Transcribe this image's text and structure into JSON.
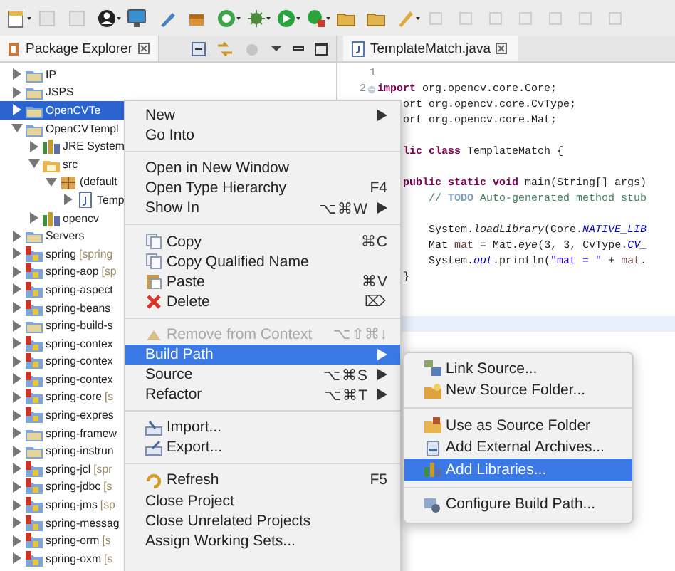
{
  "explorer": {
    "title": "Package Explorer",
    "tree": [
      {
        "label": "IP",
        "kind": "project",
        "expanded": false,
        "selected": false
      },
      {
        "label": "JSPS",
        "kind": "project",
        "expanded": false,
        "selected": false
      },
      {
        "label": "OpenCVTe",
        "kind": "project",
        "expanded": false,
        "selected": true
      },
      {
        "label": "OpenCVTempl",
        "kind": "project",
        "expanded": true,
        "selected": false,
        "children": [
          {
            "label": "JRE System",
            "kind": "library",
            "expanded": false,
            "selected": false
          },
          {
            "label": "src",
            "kind": "folder",
            "expanded": true,
            "selected": false,
            "children": [
              {
                "label": "(default",
                "kind": "package",
                "expanded": true,
                "selected": false,
                "children": [
                  {
                    "label": "Temp",
                    "kind": "java",
                    "expanded": false,
                    "selected": false
                  }
                ]
              }
            ]
          },
          {
            "label": "opencv",
            "kind": "library",
            "expanded": false,
            "selected": false
          }
        ]
      },
      {
        "label": "Servers",
        "kind": "project",
        "expanded": false,
        "selected": false
      },
      {
        "label": "spring",
        "decoration": "[spring",
        "kind": "spring",
        "expanded": false,
        "selected": false
      },
      {
        "label": "spring-aop",
        "decoration": "[sp",
        "kind": "spring",
        "expanded": false,
        "selected": false
      },
      {
        "label": "spring-aspect",
        "kind": "spring",
        "expanded": false,
        "selected": false
      },
      {
        "label": "spring-beans",
        "kind": "spring",
        "expanded": false,
        "selected": false
      },
      {
        "label": "spring-build-s",
        "kind": "project",
        "expanded": false,
        "selected": false
      },
      {
        "label": "spring-contex",
        "kind": "spring",
        "expanded": false,
        "selected": false
      },
      {
        "label": "spring-contex",
        "kind": "spring",
        "expanded": false,
        "selected": false
      },
      {
        "label": "spring-contex",
        "kind": "spring",
        "expanded": false,
        "selected": false
      },
      {
        "label": "spring-core",
        "decoration": "[s",
        "kind": "spring",
        "expanded": false,
        "selected": false
      },
      {
        "label": "spring-expres",
        "kind": "spring",
        "expanded": false,
        "selected": false
      },
      {
        "label": "spring-framew",
        "kind": "project",
        "expanded": false,
        "selected": false
      },
      {
        "label": "spring-instrun",
        "kind": "project",
        "expanded": false,
        "selected": false
      },
      {
        "label": "spring-jcl",
        "decoration": "[spr",
        "kind": "spring",
        "expanded": false,
        "selected": false
      },
      {
        "label": "spring-jdbc",
        "decoration": "[s",
        "kind": "spring",
        "expanded": false,
        "selected": false
      },
      {
        "label": "spring-jms",
        "decoration": "[sp",
        "kind": "spring",
        "expanded": false,
        "selected": false
      },
      {
        "label": "spring-messag",
        "kind": "spring",
        "expanded": false,
        "selected": false
      },
      {
        "label": "spring-orm",
        "decoration": "[s",
        "kind": "spring",
        "expanded": false,
        "selected": false
      },
      {
        "label": "spring-oxm",
        "decoration": "[s",
        "kind": "spring",
        "expanded": false,
        "selected": false
      }
    ]
  },
  "editor": {
    "tab": "TemplateMatch.java",
    "lines": [
      {
        "kind": "full",
        "number": "1"
      },
      {
        "kind": "folded",
        "number": "2",
        "parts": [
          {
            "t": "import",
            "kind": "keyword"
          },
          {
            "t": " org.opencv.core.Core;",
            "kind": "plain"
          }
        ]
      },
      {
        "kind": "clipped",
        "parts": [
          {
            "t": "ort org.opencv.core.CvType;",
            "kind": "plain"
          }
        ]
      },
      {
        "kind": "clipped",
        "parts": [
          {
            "t": "ort org.opencv.core.Mat;",
            "kind": "plain"
          }
        ]
      },
      {
        "kind": "blank"
      },
      {
        "kind": "clipped",
        "parts": [
          {
            "t": "lic class",
            "kind": "keyword"
          },
          {
            "t": " TemplateMatch {",
            "kind": "plain"
          }
        ]
      },
      {
        "kind": "blank"
      },
      {
        "kind": "full",
        "parts": [
          {
            "t": "    public static void",
            "kind": "keyword"
          },
          {
            "t": " main(String[] args)",
            "kind": "plain"
          }
        ]
      },
      {
        "kind": "full",
        "parts": [
          {
            "t": "        // ",
            "kind": "comment"
          },
          {
            "t": "TODO",
            "kind": "task"
          },
          {
            "t": " Auto-generated method stub",
            "kind": "comment"
          }
        ]
      },
      {
        "kind": "blank"
      },
      {
        "kind": "full",
        "parts": [
          {
            "t": "        System.",
            "kind": "plain"
          },
          {
            "t": "loadLibrary",
            "kind": "method"
          },
          {
            "t": "(Core.",
            "kind": "plain"
          },
          {
            "t": "NATIVE_LIB",
            "kind": "field"
          }
        ]
      },
      {
        "kind": "full",
        "parts": [
          {
            "t": "        Mat ",
            "kind": "plain"
          },
          {
            "t": "mat",
            "kind": "variable"
          },
          {
            "t": " = Mat.",
            "kind": "plain"
          },
          {
            "t": "eye",
            "kind": "method"
          },
          {
            "t": "(3, 3, CvType.",
            "kind": "plain"
          },
          {
            "t": "CV_",
            "kind": "field"
          }
        ]
      },
      {
        "kind": "full",
        "parts": [
          {
            "t": "        System.",
            "kind": "plain"
          },
          {
            "t": "out",
            "kind": "field"
          },
          {
            "t": ".println(",
            "kind": "plain"
          },
          {
            "t": "\"mat = \"",
            "kind": "string"
          },
          {
            "t": " + ",
            "kind": "plain"
          },
          {
            "t": "mat",
            "kind": "variable"
          },
          {
            "t": ".",
            "kind": "plain"
          }
        ]
      },
      {
        "kind": "full",
        "parts": [
          {
            "t": "    }",
            "kind": "plain"
          }
        ]
      },
      {
        "kind": "blank"
      },
      {
        "kind": "blank"
      },
      {
        "kind": "current"
      }
    ]
  },
  "context_menu": {
    "items": [
      {
        "kind": "item",
        "label": "New",
        "submenu": true,
        "disabled": false,
        "selected": false
      },
      {
        "kind": "item",
        "label": "Go Into",
        "submenu": false,
        "disabled": false,
        "selected": false
      },
      {
        "kind": "separator"
      },
      {
        "kind": "item",
        "label": "Open in New Window",
        "submenu": false,
        "disabled": false,
        "selected": false
      },
      {
        "kind": "item",
        "label": "Open Type Hierarchy",
        "shortcut": "F4",
        "submenu": false,
        "disabled": false,
        "selected": false
      },
      {
        "kind": "item",
        "label": "Show In",
        "shortcut": "⌥⌘W",
        "submenu": true,
        "disabled": false,
        "selected": false
      },
      {
        "kind": "separator"
      },
      {
        "kind": "copy",
        "label": "Copy",
        "shortcut": "⌘C",
        "submenu": false,
        "disabled": false,
        "selected": false
      },
      {
        "kind": "copy",
        "label": "Copy Qualified Name",
        "submenu": false,
        "disabled": false,
        "selected": false
      },
      {
        "kind": "paste",
        "label": "Paste",
        "shortcut": "⌘V",
        "submenu": false,
        "disabled": false,
        "selected": false
      },
      {
        "kind": "delete",
        "label": "Delete",
        "shortcut": "⌦",
        "submenu": false,
        "disabled": false,
        "selected": false
      },
      {
        "kind": "separator"
      },
      {
        "kind": "remove",
        "label": "Remove from Context",
        "shortcut": "⌥⇧⌘↓",
        "submenu": false,
        "disabled": true,
        "selected": false
      },
      {
        "kind": "item",
        "label": "Build Path",
        "submenu": true,
        "disabled": false,
        "selected": true
      },
      {
        "kind": "item",
        "label": "Source",
        "shortcut": "⌥⌘S",
        "submenu": true,
        "disabled": false,
        "selected": false
      },
      {
        "kind": "item",
        "label": "Refactor",
        "shortcut": "⌥⌘T",
        "submenu": true,
        "disabled": false,
        "selected": false
      },
      {
        "kind": "separator"
      },
      {
        "kind": "import",
        "label": "Import...",
        "submenu": false,
        "disabled": false,
        "selected": false
      },
      {
        "kind": "export",
        "label": "Export...",
        "submenu": false,
        "disabled": false,
        "selected": false
      },
      {
        "kind": "separator"
      },
      {
        "kind": "refresh",
        "label": "Refresh",
        "shortcut": "F5",
        "submenu": false,
        "disabled": false,
        "selected": false
      },
      {
        "kind": "item",
        "label": "Close Project",
        "submenu": false,
        "disabled": false,
        "selected": false
      },
      {
        "kind": "item",
        "label": "Close Unrelated Projects",
        "submenu": false,
        "disabled": false,
        "selected": false
      },
      {
        "kind": "item",
        "label": "Assign Working Sets...",
        "submenu": false,
        "disabled": false,
        "selected": false
      }
    ]
  },
  "submenu": {
    "items": [
      {
        "kind": "link",
        "label": "Link Source...",
        "selected": false
      },
      {
        "kind": "folder",
        "label": "New Source Folder...",
        "selected": false
      },
      {
        "kind": "separator"
      },
      {
        "kind": "source",
        "label": "Use as Source Folder",
        "selected": false
      },
      {
        "kind": "jar",
        "label": "Add External Archives...",
        "selected": false
      },
      {
        "kind": "library",
        "label": "Add Libraries...",
        "selected": true
      },
      {
        "kind": "separator"
      },
      {
        "kind": "config",
        "label": "Configure Build Path...",
        "selected": false
      }
    ]
  }
}
